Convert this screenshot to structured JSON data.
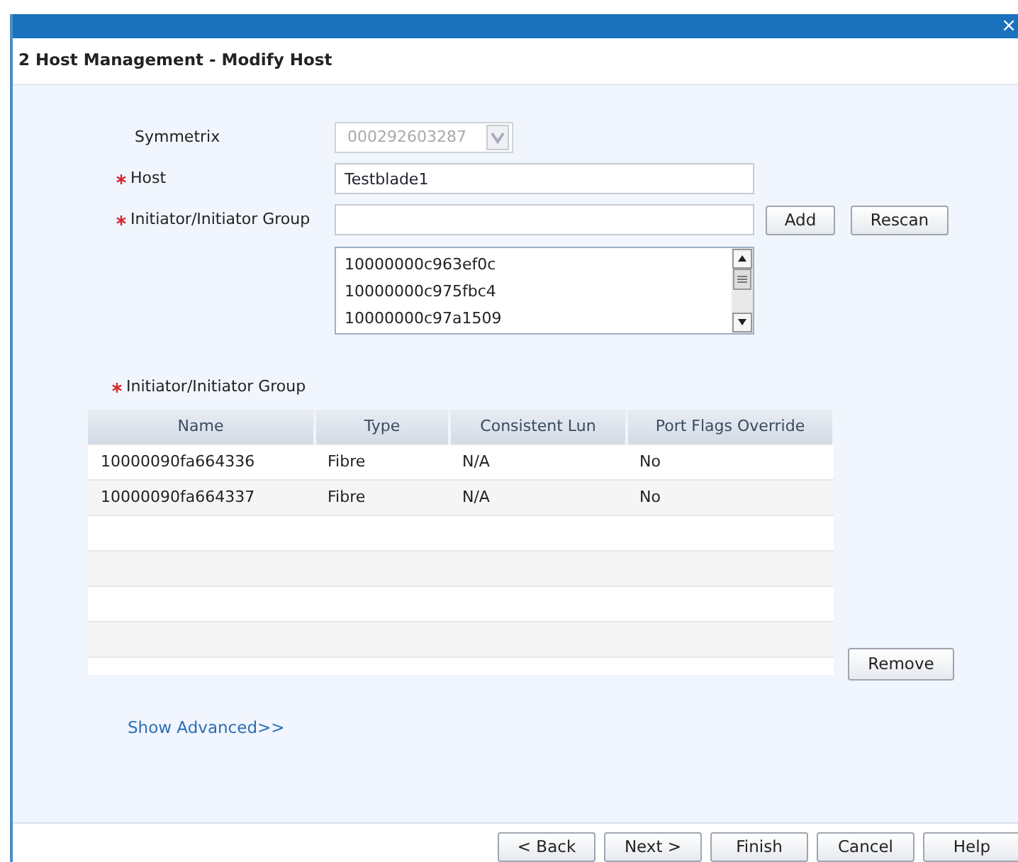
{
  "window": {
    "close": "×",
    "title": "2  Host Management - Modify Host"
  },
  "form": {
    "symmetrix": {
      "label": "Symmetrix",
      "value": "000292603287",
      "disabled": true,
      "required": false
    },
    "host": {
      "label": "Host",
      "value": "Testblade1",
      "required": true
    },
    "initiator": {
      "label": "Initiator/Initiator Group",
      "required": true
    },
    "add": "Add",
    "rescan": "Rescan",
    "initiator_list": [
      "10000000c963ef0c",
      "10000000c975fbc4",
      "10000000c97a1509"
    ]
  },
  "group": {
    "label": "Initiator/Initiator Group",
    "required": true,
    "table": {
      "columns": [
        "Name",
        "Type",
        "Consistent Lun",
        "Port Flags Override"
      ],
      "rows": [
        [
          "10000090fa664336",
          "Fibre",
          "N/A",
          "No"
        ],
        [
          "10000090fa664337",
          "Fibre",
          "N/A",
          "No"
        ]
      ]
    },
    "remove": "Remove"
  },
  "show_advanced": "Show Advanced>>",
  "buttons": [
    "< Back",
    "Next >",
    "Finish",
    "Cancel",
    "Help"
  ]
}
